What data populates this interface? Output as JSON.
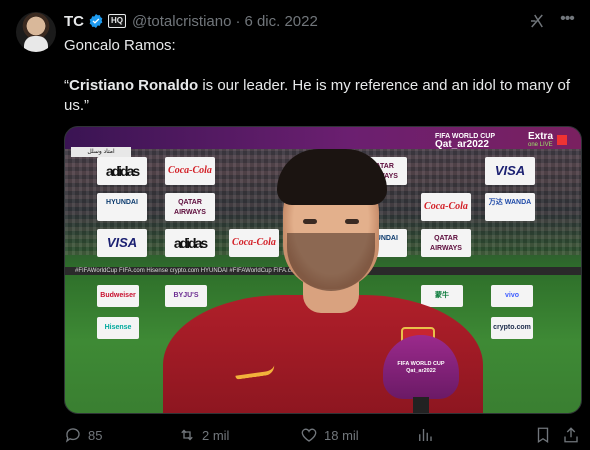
{
  "tweet": {
    "author_name": "TC",
    "handle": "@totalcristiano",
    "separator": "·",
    "date": "6 dic. 2022",
    "badge": "HQ",
    "text_intro": "Goncalo Ramos:",
    "quote_open": "“",
    "quote_name": "Cristiano Ronaldo",
    "quote_rest": " is our leader. He is my reference and an idol to many of us.”"
  },
  "media": {
    "broadcast": {
      "event_line1": "FIFA WORLD CUP",
      "event_line2": "Qat_ar2022",
      "channel": "Extra",
      "channel_sub": "one LIVE",
      "corner_tag": "امتاد وسلل"
    },
    "boards_row1": [
      "adidas",
      "Coca-Cola",
      "QATAR AIRWAYS",
      "VISA"
    ],
    "boards_row2": [
      "HYUNDAI",
      "QATAR AIRWAYS",
      "Coca-Cola",
      "万达 WANDA"
    ],
    "boards_row3": [
      "VISA",
      "adidas",
      "Coca-Cola",
      "HYUNDAI",
      "QATAR AIRWAYS"
    ],
    "led_text": "#FIFAWorldCup   FIFA.com   Hisense   crypto.com   HYUNDAI   #FIFAWorldCup   FIFA.com   Budweiser   vivo",
    "lower_boards": [
      "Budweiser",
      "BYJU'S",
      "蒙牛",
      "vivo",
      "Hisense",
      "crypto.com"
    ],
    "mic_text": "FIFA WORLD CUP Qat_ar2022"
  },
  "actions": {
    "replies": "85",
    "reposts": "2 mil",
    "likes": "18 mil"
  },
  "icons": [
    "verified-icon",
    "grok-icon",
    "more-icon",
    "reply-icon",
    "repost-icon",
    "like-icon",
    "views-icon",
    "bookmark-icon",
    "share-icon"
  ],
  "colors": {
    "background": "#000000",
    "text": "#e7e9ea",
    "muted": "#71767b",
    "verified": "#1d9bf0"
  }
}
